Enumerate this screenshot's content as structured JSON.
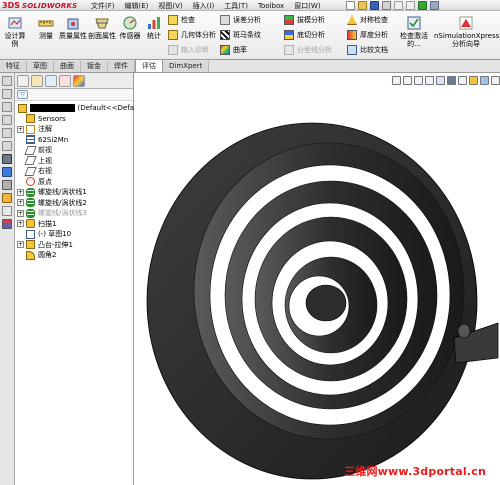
{
  "app": {
    "logo_ds": "3DS",
    "logo_text": "SOLIDWORKS"
  },
  "menubar": [
    {
      "label": "文件(F)"
    },
    {
      "label": "编辑(E)"
    },
    {
      "label": "视图(V)"
    },
    {
      "label": "插入(I)"
    },
    {
      "label": "工具(T)"
    },
    {
      "label": "Toolbox"
    },
    {
      "label": "窗口(W)"
    }
  ],
  "ribbon": {
    "design_study": "设计算例",
    "measure": "测量",
    "mass_props": "质量属性",
    "section_props": "剖面属性",
    "sensor": "传感器",
    "stats": "统计",
    "check": "检查",
    "geometry_analysis": "几何体分析",
    "import_diagnostics": "输入诊断",
    "deviation": "误差分析",
    "zebra": "斑马条纹",
    "curvature": "曲率",
    "draft": "拔模分析",
    "undercut": "底切分析",
    "parting_line": "分型线分析",
    "symmetry": "对称检查",
    "thickness": "厚度分析",
    "compare": "比较文档",
    "check_active": "检查激活的...",
    "simxpress": "nSimulationXpress 分析向导"
  },
  "tabs": [
    {
      "label": "特征",
      "active": false
    },
    {
      "label": "草图",
      "active": false
    },
    {
      "label": "曲面",
      "active": false
    },
    {
      "label": "钣金",
      "active": false
    },
    {
      "label": "焊件",
      "active": false
    },
    {
      "label": "评估",
      "active": true
    },
    {
      "label": "DimXpert",
      "active": false
    }
  ],
  "featuretree": {
    "root_suffix": "(Default<<Defa",
    "items": [
      {
        "label": "Sensors",
        "icon": "folder-icon",
        "expand": false,
        "disabled": false
      },
      {
        "label": "注解",
        "icon": "annotation-icon",
        "expand": true,
        "disabled": false
      },
      {
        "label": "62Si2Mn",
        "icon": "material-icon",
        "expand": false,
        "disabled": false
      },
      {
        "label": "前视",
        "icon": "plane-icon",
        "expand": false,
        "disabled": false
      },
      {
        "label": "上视",
        "icon": "plane-icon",
        "expand": false,
        "disabled": false
      },
      {
        "label": "右视",
        "icon": "plane-icon",
        "expand": false,
        "disabled": false
      },
      {
        "label": "原点",
        "icon": "origin-icon",
        "expand": false,
        "disabled": false
      },
      {
        "label": "螺旋线/涡状线1",
        "icon": "helix-icon",
        "expand": true,
        "disabled": false
      },
      {
        "label": "螺旋线/涡状线2",
        "icon": "helix-icon",
        "expand": true,
        "disabled": false
      },
      {
        "label": "螺旋线/涡状线3",
        "icon": "helix-icon",
        "expand": true,
        "disabled": true
      },
      {
        "label": "扫描1",
        "icon": "sweep-icon",
        "expand": true,
        "disabled": false
      },
      {
        "label": "(-) 草图10",
        "icon": "sketch-icon",
        "expand": false,
        "disabled": false
      },
      {
        "label": "凸台-拉伸1",
        "icon": "extrude-icon",
        "expand": true,
        "disabled": false
      },
      {
        "label": "圆角2",
        "icon": "fillet-icon",
        "expand": false,
        "disabled": false
      }
    ]
  },
  "watermark": "三维网www.3dportal.cn",
  "colors": {
    "accent_red": "#c8102e",
    "toolbar_bg": "#eaeaea",
    "model": "#2a2a2a",
    "watermark": "#ee1a1a"
  }
}
